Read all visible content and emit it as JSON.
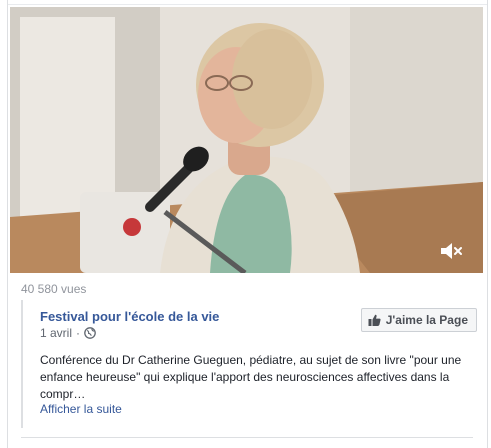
{
  "video": {
    "mute_icon": "volume-muted-icon"
  },
  "stats": {
    "views": "40 580 vues"
  },
  "post": {
    "page_name": "Festival pour l'école de la vie",
    "date": "1 avril",
    "separator": "·",
    "privacy_icon": "globe-icon",
    "like_button_label": "J'aime la Page",
    "like_icon": "thumbs-up-icon",
    "description_lines": [
      "Conférence du Dr Catherine Gueguen, pédiatre, au sujet de son livre \"pour une",
      "enfance heureuse\" qui explique l'apport des neurosciences affectives dans la",
      "compr…"
    ],
    "see_more": "Afficher la suite"
  },
  "colors": {
    "link": "#365899",
    "meta": "#616770",
    "views": "#90949c",
    "button_bg": "#f5f6f7"
  }
}
